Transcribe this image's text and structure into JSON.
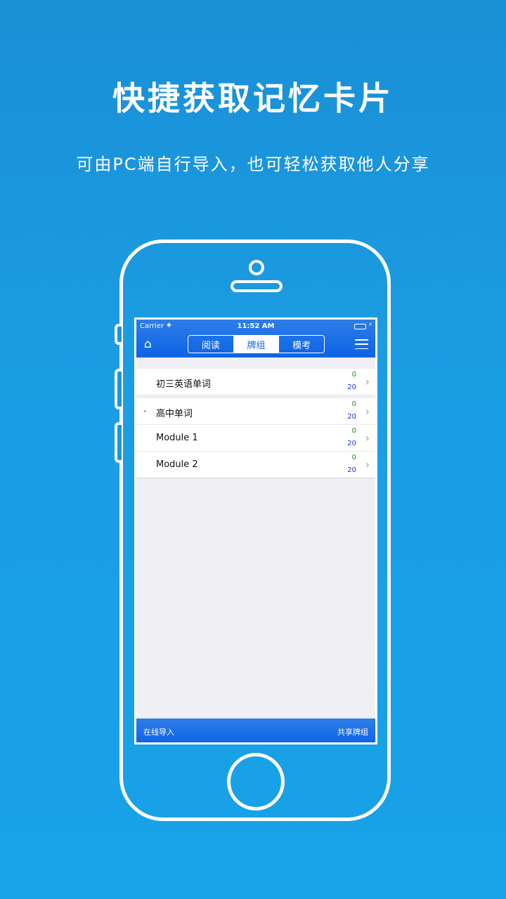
{
  "promo": {
    "headline": "快捷获取记忆卡片",
    "subheadline": "可由PC端自行导入，也可轻松获取他人分享"
  },
  "status_bar": {
    "carrier": "Carrier",
    "time": "11:52 AM"
  },
  "nav": {
    "tabs": [
      {
        "label": "阅读",
        "active": false
      },
      {
        "label": "牌组",
        "active": true
      },
      {
        "label": "模考",
        "active": false
      }
    ]
  },
  "decks": [
    {
      "name": "初三英语单词",
      "prefix": "",
      "top": "0",
      "bottom": "20"
    },
    {
      "name": "高中单词",
      "prefix": "-",
      "top": "0",
      "bottom": "20"
    },
    {
      "name": "Module 1",
      "prefix": "",
      "top": "0",
      "bottom": "20"
    },
    {
      "name": "Module 2",
      "prefix": "",
      "top": "0",
      "bottom": "20"
    }
  ],
  "bottom_bar": {
    "left_label": "在线导入",
    "right_label": "共享牌组"
  },
  "colors": {
    "background": "#1b9ee3",
    "navbar": "#0c63e6",
    "count_new": "#1a8a1a",
    "count_total": "#1a2fd6"
  }
}
